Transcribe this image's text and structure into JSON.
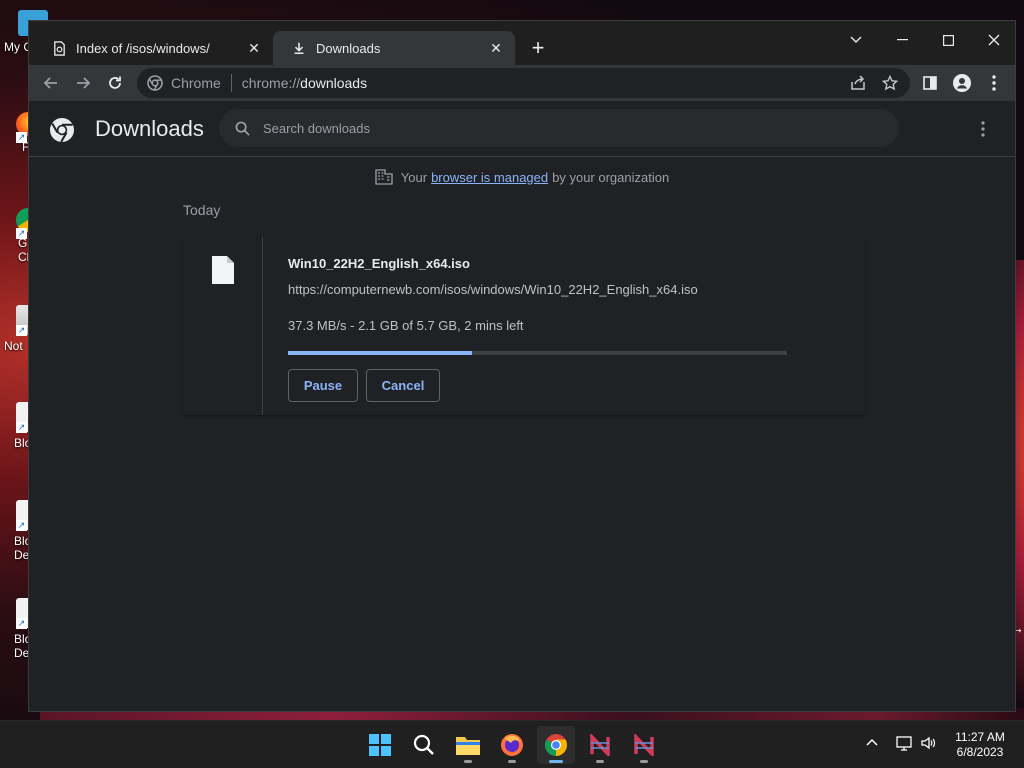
{
  "desktop": {
    "icons": [
      {
        "label": "My C"
      },
      {
        "label": "F"
      },
      {
        "label": "G\nCh"
      },
      {
        "label": "Not"
      },
      {
        "label": "Blo"
      },
      {
        "label": "Blo\nDe"
      },
      {
        "label": "Blo\nDe"
      }
    ]
  },
  "tabs": [
    {
      "title": "Index of /isos/windows/",
      "icon": "page-icon"
    },
    {
      "title": "Downloads",
      "icon": "download-icon"
    }
  ],
  "toolbar": {
    "chip_label": "Chrome",
    "url_scheme": "chrome://",
    "url_host": "downloads"
  },
  "page": {
    "title": "Downloads",
    "search_placeholder": "Search downloads",
    "managed_prefix": "Your",
    "managed_link": "browser is managed",
    "managed_suffix": "by your organization",
    "section_label": "Today"
  },
  "download": {
    "file_name": "Win10_22H2_English_x64.iso",
    "url": "https://computernewb.com/isos/windows/Win10_22H2_English_x64.iso",
    "status": "37.3 MB/s - 2.1 GB of 5.7 GB, 2 mins left",
    "progress_fraction": 0.368,
    "pause_label": "Pause",
    "cancel_label": "Cancel"
  },
  "taskbar": {
    "time": "11:27 AM",
    "date": "6/8/2023"
  },
  "colors": {
    "accent": "#8ab4f8",
    "window_bg": "#202124",
    "toolbar_bg": "#35363a"
  }
}
